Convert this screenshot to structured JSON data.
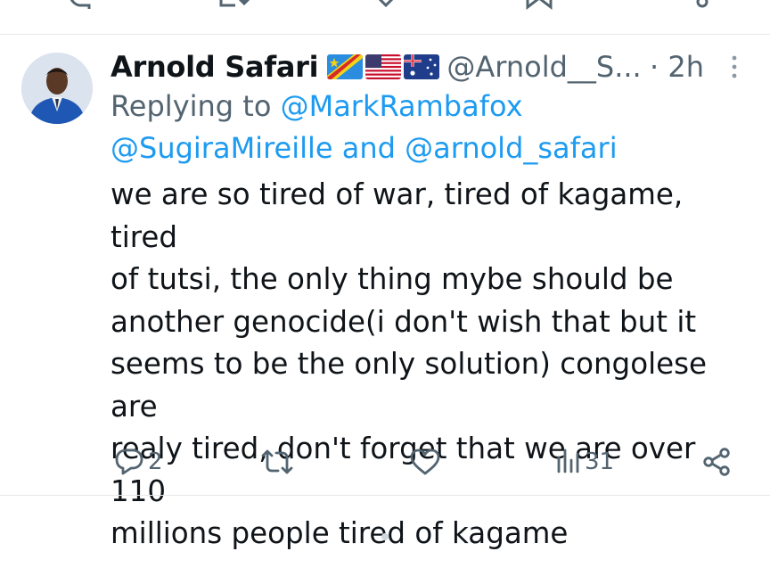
{
  "tweet": {
    "author_name": "Arnold Safari",
    "flags": [
      "dr-congo-flag-icon",
      "usa-flag-icon",
      "australia-flag-icon"
    ],
    "handle": "@Arnold__S...",
    "time": "· 2h",
    "replying_to_prefix": "Replying to",
    "mention_1": "@MarkRambafox",
    "mention_2": "@SugiraMireille",
    "and_text": "and",
    "mention_3": "@arnold_safari",
    "text": "we are so tired of war, tired of kagame, tired\nof tutsi, the only thing mybe should be\nanother genocide(i don't wish that but it\nseems to be the only solution) congolese are\nrealy tired, don't forget that we are over 110\nmillions people tired of kagame"
  },
  "actions": {
    "reply_count": "2",
    "retweet_count": "",
    "like_count": "",
    "views_count": "31"
  },
  "colors": {
    "link": "#1d9bf0",
    "secondary_text": "#536471",
    "primary_text": "#0f1419",
    "divider": "#e6e8eb"
  },
  "icons": [
    "reply-icon",
    "retweet-icon",
    "like-icon",
    "views-icon",
    "share-icon",
    "more-icon",
    "bookmark-icon"
  ]
}
